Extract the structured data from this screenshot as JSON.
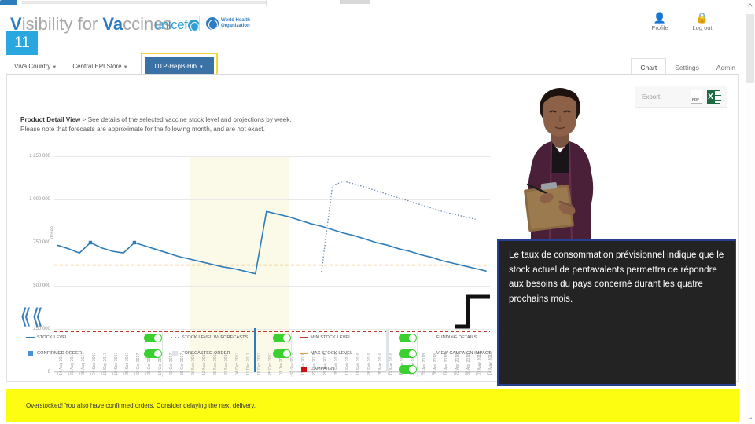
{
  "app": {
    "brand_prefix": "V",
    "brand_main": "isibility for V",
    "brand_accent2": "a",
    "brand_suffix": "ccines",
    "brand_full": "Visibility for Vaccines",
    "unicef_label": "unicef",
    "who_line1": "World Health",
    "who_line2": "Organization"
  },
  "user": {
    "profile_label": "Profile",
    "logout_label": "Log out",
    "profile_icon": "person-icon",
    "logout_icon": "lock-icon"
  },
  "slide": {
    "number": "11"
  },
  "nav": {
    "items": [
      {
        "label": "ViVa Country",
        "caret": "▾",
        "selected": false
      },
      {
        "label": "Central EPI Store",
        "caret": "▾",
        "selected": false
      },
      {
        "label": "DTP-HepB-Hib",
        "caret": "▾",
        "selected": true
      }
    ]
  },
  "tabs": [
    {
      "label": "Chart",
      "active": true
    },
    {
      "label": "Settings",
      "active": false
    },
    {
      "label": "Admin",
      "active": false
    }
  ],
  "export": {
    "label": "Export:",
    "pdf_icon": "pdf-file-icon",
    "excel_icon": "excel-file-icon"
  },
  "product_detail": {
    "title": "Product Detail View",
    "line1_rest": " > See details of the selected vaccine stock level and projections by week.",
    "line2": "Please note that forecasts are approximate for the following month, and are not exact."
  },
  "chart_data": {
    "type": "line",
    "title": "",
    "xlabel": "",
    "ylabel": "doses",
    "ylim": [
      0,
      1250000
    ],
    "yticks": [
      0,
      250000,
      500000,
      750000,
      1000000,
      1250000
    ],
    "ytick_labels": [
      "0",
      "250 000",
      "500 000",
      "750 000",
      "1 000 000",
      "1 250 000"
    ],
    "grid": true,
    "legend_position": "bottom",
    "categories": [
      "14 Aug 2017",
      "21 Aug 2017",
      "28 Aug 2017",
      "04 Sep 2017",
      "11 Sep 2017",
      "18 Sep 2017",
      "25 Sep 2017",
      "02 Oct 2017",
      "09 Oct 2017",
      "16 Oct 2017",
      "23 Oct 2017",
      "30 Oct 2017",
      "06 Nov 2017",
      "13 Nov 2017",
      "20 Nov 2017",
      "27 Nov 2017",
      "04 Dec 2017",
      "11 Dec 2017",
      "18 Dec 2017",
      "25 Dec 2017",
      "01 Jan 2018",
      "08 Jan 2018",
      "15 Jan 2018",
      "22 Jan 2018",
      "29 Jan 2018",
      "05 Feb 2018",
      "12 Feb 2018",
      "19 Feb 2018",
      "26 Feb 2018",
      "05 Mar 2018",
      "12 Mar 2018",
      "19 Mar 2018",
      "26 Mar 2018",
      "02 Apr 2018",
      "09 Apr 2018",
      "16 Apr 2018",
      "23 Apr 2018",
      "30 Apr 2018",
      "07 May 2018",
      "14 May 2018"
    ],
    "today_index": 12,
    "forecast_band": {
      "start_index": 12,
      "end_index": 21
    },
    "series": [
      {
        "name": "STOCK LEVEL",
        "style": "solid",
        "color": "#2d7cb8",
        "values": [
          735000,
          715000,
          690000,
          750000,
          720000,
          700000,
          690000,
          750000,
          730000,
          710000,
          690000,
          670000,
          655000,
          640000,
          625000,
          610000,
          600000,
          585000,
          570000,
          930000,
          915000,
          900000,
          880000,
          860000,
          845000,
          825000,
          805000,
          790000,
          770000,
          750000,
          735000,
          715000,
          700000,
          680000,
          665000,
          645000,
          630000,
          615000,
          600000,
          585000
        ],
        "markers_at": [
          3,
          7
        ]
      },
      {
        "name": "STOCK LEVEL W/ FORECASTS",
        "style": "dotted",
        "color": "#6f8fb5",
        "values": [
          null,
          null,
          null,
          null,
          null,
          null,
          null,
          null,
          null,
          null,
          null,
          null,
          null,
          null,
          null,
          null,
          null,
          null,
          null,
          null,
          null,
          null,
          null,
          null,
          580000,
          1080000,
          1105000,
          1090000,
          1070000,
          1050000,
          1030000,
          1010000,
          990000,
          970000,
          950000,
          930000,
          915000,
          900000,
          885000,
          null
        ]
      }
    ],
    "threshold_lines": [
      {
        "name": "MIN STOCK LEVEL",
        "value": 235000,
        "color": "#c0392b",
        "style": "dashed"
      },
      {
        "name": "MAX STOCK LEVEL",
        "value": 620000,
        "color": "#e8a33d",
        "style": "dashed"
      }
    ],
    "bars": [
      {
        "name": "CONFIRMED ORDER",
        "index": 18,
        "value": 255000,
        "color": "#2d7cb8"
      },
      {
        "name": "FORECASTED ORDER",
        "index": 30,
        "value": 250000,
        "color": "#dfe3e6"
      }
    ]
  },
  "legend": {
    "columns": [
      {
        "rows": [
          {
            "label": "STOCK LEVEL",
            "marker": "marker-line-solid",
            "color": "#2d7cb8",
            "toggle": "on"
          },
          {
            "label": "CONFIRMED ORDER",
            "marker": "marker-square",
            "color": "#4a90d9",
            "toggle": "on"
          }
        ]
      },
      {
        "rows": [
          {
            "label": "STOCK LEVEL W/ FORECASTS",
            "marker": "marker-line-dotted",
            "color": "#8aa3bd",
            "toggle": "on"
          },
          {
            "label": "FORECASTED ORDER",
            "marker": "marker-square",
            "color": "#dde3e8",
            "toggle": "on"
          }
        ]
      },
      {
        "rows": [
          {
            "label": "MIN STOCK LEVEL",
            "marker": "marker-line-dashed",
            "color": "#c0392b",
            "toggle": "on"
          },
          {
            "label": "MAX STOCK LEVEL",
            "marker": "marker-line-dashed",
            "color": "#e8a33d",
            "toggle": "on"
          },
          {
            "label": "CAMPAIGN",
            "marker": "marker-square",
            "color": "#cc1111",
            "toggle": "on"
          }
        ]
      },
      {
        "rows": [
          {
            "label": "FUNDING DETAILS",
            "marker": "none",
            "color": "",
            "toggle": "off"
          },
          {
            "label": "VIEW CAMPAIGN IMPACT",
            "marker": "none",
            "color": "",
            "toggle": "off"
          }
        ]
      }
    ]
  },
  "navigation": {
    "prev_icon": "double-chevron-left-icon",
    "next_icon": "double-chevron-right-icon"
  },
  "warning": {
    "text": "Overstocked! You also have confirmed orders. Consider delaying the next delivery."
  },
  "tooltip": {
    "text": "Le taux de consommation prévisionnel indique que le stock actuel de pentavalents permettra de répondre aux besoins du pays concerné durant les quatre prochains mois."
  },
  "colors": {
    "brand_blue": "#2e7cc0",
    "badge_blue": "#29a8df",
    "nav_selected": "#3b72a6",
    "highlight_yellow": "#f5d833",
    "warning_yellow": "#fdfd12",
    "toggle_on": "#3ad02f",
    "tooltip_border": "#25408f",
    "tooltip_bg": "#232323"
  }
}
